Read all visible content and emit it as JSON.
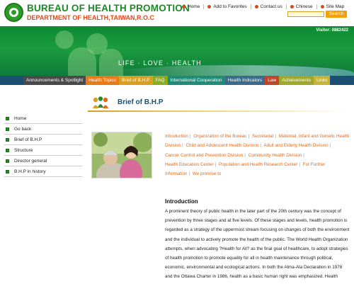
{
  "header": {
    "title": "BUREAU OF HEALTH PROMOTION",
    "subtitle": "DEPARTMENT OF HEALTH,TAIWAN,R.O.C",
    "top_links": [
      {
        "label": "Home"
      },
      {
        "label": "Add to Favorites"
      },
      {
        "label": "Contact us"
      },
      {
        "label": "Chinese"
      },
      {
        "label": "Site Map"
      }
    ],
    "search_button": "Search",
    "search_placeholder": ""
  },
  "banner": {
    "visitor": "Visitor: 0882422",
    "tagline": "LIFE · LOVE · HEALTH"
  },
  "nav": {
    "items": [
      {
        "label": "Announcements & Spotlight"
      },
      {
        "label": "Health Topics"
      },
      {
        "label": "Brief of B.H.P"
      },
      {
        "label": "FAQ"
      },
      {
        "label": "International Cooperation"
      },
      {
        "label": "Health Indicators"
      },
      {
        "label": "Law"
      },
      {
        "label": "Achievements"
      },
      {
        "label": "Links"
      }
    ]
  },
  "sidebar": {
    "items": [
      {
        "label": "Home"
      },
      {
        "label": "Go back"
      },
      {
        "label": "Brief of B.H.P"
      },
      {
        "label": "Structure"
      },
      {
        "label": "Director general"
      },
      {
        "label": "B.H.P in history"
      }
    ]
  },
  "page": {
    "heading": "Brief of B.H.P",
    "links": [
      "Introduction",
      "Organization of the Bureau",
      "Secretariat",
      "Maternal, Infant and Genetic Health Division",
      "Child and Adolescent Health Division",
      "Adult and Elderly Health Division",
      "Cancer Control and Prevention Division",
      "Community Health Division",
      "Health Education Center",
      "Population and Health Research Center",
      "For Further Information",
      "We promise to"
    ],
    "intro_title": "Introduction",
    "intro_text": "A prominent theory of public health in the later part of the 20th century was the concept of prevention by three stages and at five levels. Of these stages and levels, health promotion is regarded as a strategy of the uppermost stream focusing on changes of both the environment and the individual to actively promote the health of the public. The World Health Organization attempts, when advocating ?Health for All? as the final goal of healthcare, to adopt strategies of health promotion to promote equality for all in health maintenance through political, economic, environmental and ecological actions. In both the Alma-Ata Declaration in 1978 and the Ottawa Charter in 1986, health as a basic human right was emphasized. Health"
  },
  "colors": {
    "brand_green": "#1b8a25",
    "brand_orange": "#e8441a",
    "nav_blue": "#1a4f73",
    "link_orange": "#e06a1a"
  }
}
